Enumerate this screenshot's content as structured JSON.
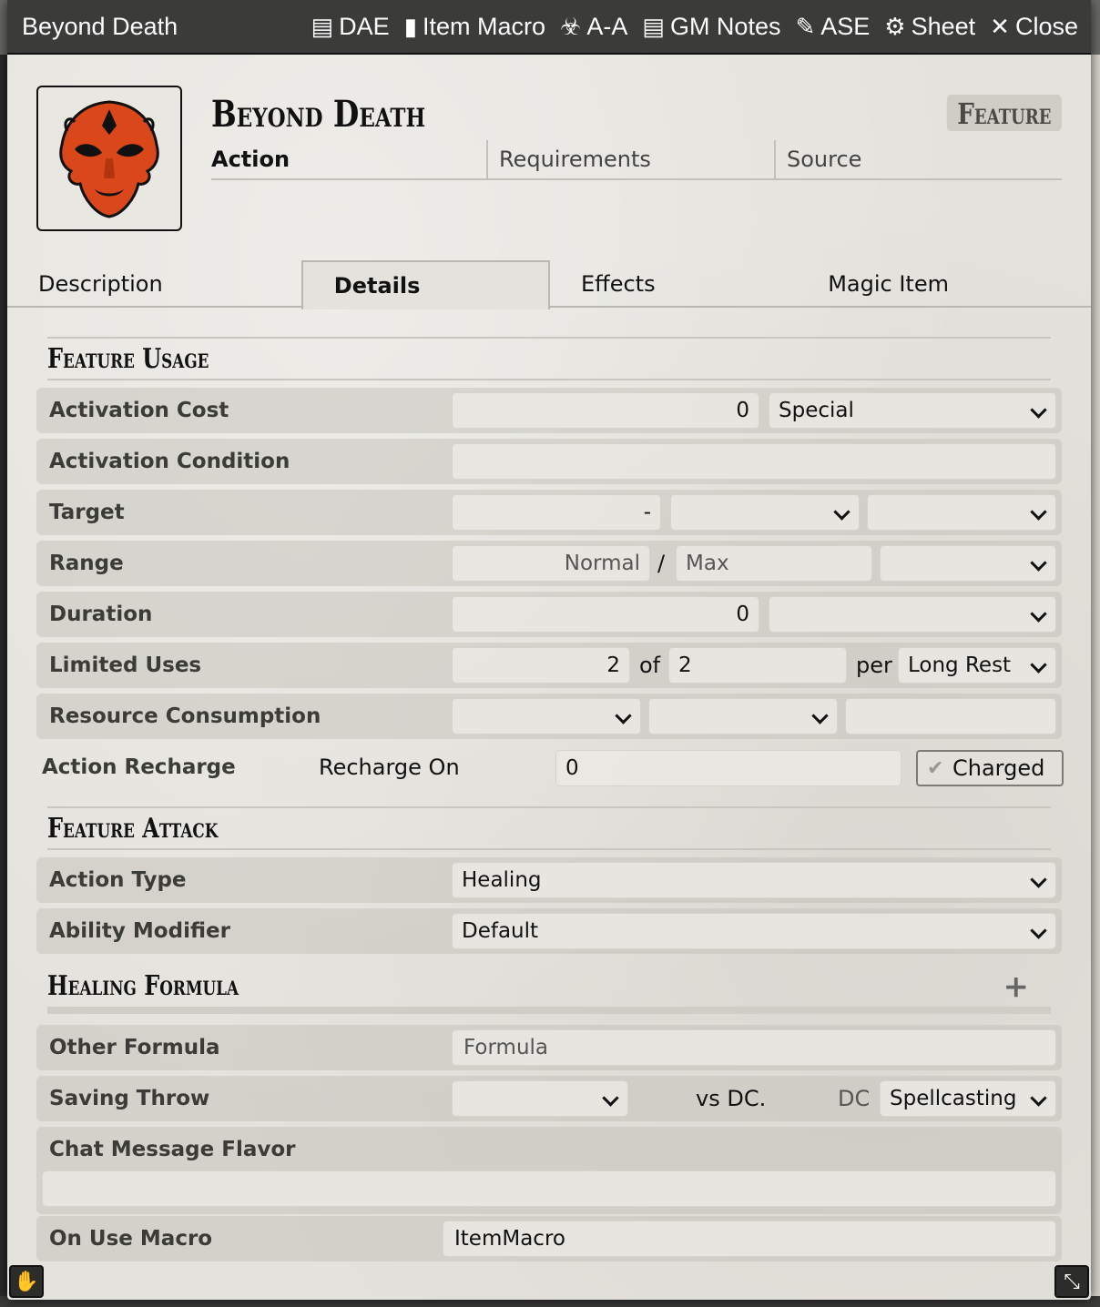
{
  "window": {
    "title": "Beyond Death"
  },
  "titlebar_buttons": [
    {
      "icon": "clipboard-icon",
      "glyph": "📋",
      "label": "DAE"
    },
    {
      "icon": "sd-card-icon",
      "glyph": "▮",
      "label": "Item Macro"
    },
    {
      "icon": "biohazard-icon",
      "glyph": "☣",
      "label": "A-A"
    },
    {
      "icon": "clipboard-icon",
      "glyph": "📋",
      "label": "GM Notes"
    },
    {
      "icon": "magic-wand-icon",
      "glyph": "✎",
      "label": "ASE"
    },
    {
      "icon": "gear-icon",
      "glyph": "⚙",
      "label": "Sheet"
    },
    {
      "icon": "close-icon",
      "glyph": "✕",
      "label": "Close"
    }
  ],
  "item": {
    "name": "Beyond Death",
    "type": "Feature",
    "summary": [
      "Action",
      "Requirements",
      "Source"
    ]
  },
  "tabs": [
    {
      "label": "Description",
      "active": false
    },
    {
      "label": "Details",
      "active": true
    },
    {
      "label": "Effects",
      "active": false
    },
    {
      "label": "Magic Item",
      "active": false
    }
  ],
  "sections": {
    "usage": "Feature Usage",
    "attack": "Feature Attack",
    "healing": "Healing Formula"
  },
  "fields": {
    "activation_cost": {
      "label": "Activation Cost",
      "value": "0",
      "type": "Special"
    },
    "activation_condition": {
      "label": "Activation Condition",
      "value": ""
    },
    "target": {
      "label": "Target",
      "value": "-",
      "type": "",
      "units": ""
    },
    "range": {
      "label": "Range",
      "normal": "Normal",
      "sep": "/",
      "max": "Max",
      "units": ""
    },
    "duration": {
      "label": "Duration",
      "value": "0",
      "units": ""
    },
    "limited_uses": {
      "label": "Limited Uses",
      "value": "2",
      "of": "of",
      "max": "2",
      "per": "per",
      "period": "Long Rest"
    },
    "resource": {
      "label": "Resource Consumption",
      "type": "",
      "target": "",
      "amount": ""
    },
    "recharge": {
      "label": "Action Recharge",
      "on_label": "Recharge On",
      "value": "0",
      "charged": "Charged"
    },
    "action_type": {
      "label": "Action Type",
      "value": "Healing"
    },
    "ability": {
      "label": "Ability Modifier",
      "value": "Default"
    },
    "other_formula": {
      "label": "Other Formula",
      "placeholder": "Formula"
    },
    "saving_throw": {
      "label": "Saving Throw",
      "ability": "",
      "vs": "vs DC.",
      "dc": "DC",
      "scaling": "Spellcasting"
    },
    "chat_flavor": {
      "label": "Chat Message Flavor",
      "value": ""
    },
    "on_use_macro": {
      "label": "On Use Macro",
      "value": "ItemMacro"
    }
  },
  "colors": {
    "titlebar": "#3b3b39",
    "portrait_mask": "#e0521f",
    "panel": "#e4e2dc"
  }
}
